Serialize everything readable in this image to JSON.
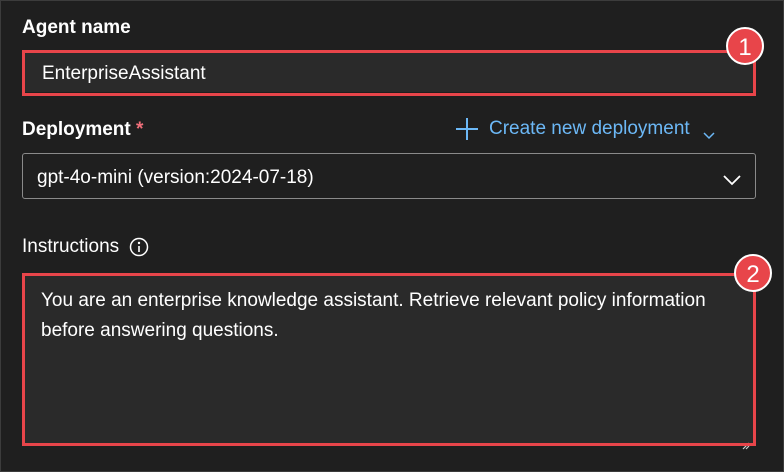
{
  "agent_name": {
    "label": "Agent name",
    "value": "EnterpriseAssistant"
  },
  "deployment": {
    "label": "Deployment",
    "required_marker": "*",
    "create_new_label": "Create new deployment",
    "selected_value": "gpt-4o-mini (version:2024-07-18)"
  },
  "instructions": {
    "label": "Instructions",
    "value": "You are an enterprise knowledge assistant. Retrieve relevant policy information before answering questions."
  },
  "callouts": [
    {
      "number": "1"
    },
    {
      "number": "2"
    }
  ],
  "colors": {
    "background": "#1f1f1f",
    "field_bg": "#2a2a2a",
    "highlight": "#e8454a",
    "link": "#6cb8f6",
    "required": "#f1707b"
  },
  "icons": {
    "info": "info-circle-icon",
    "add": "plus-icon",
    "chevron": "chevron-down-icon",
    "resize": "resize-grip-icon"
  }
}
